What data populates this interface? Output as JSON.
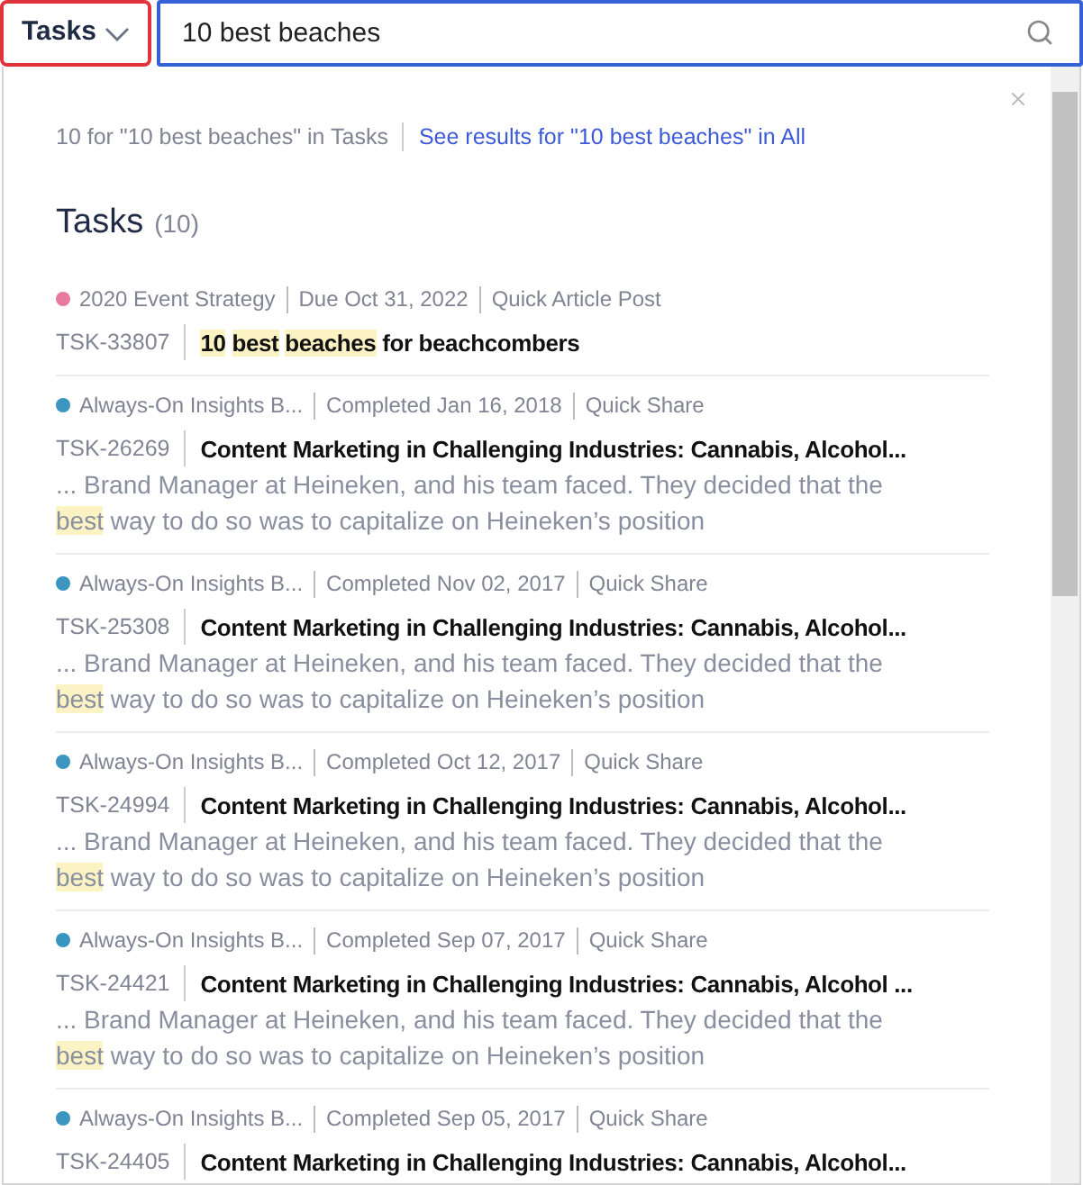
{
  "scope_dropdown": {
    "label": "Tasks"
  },
  "search": {
    "value": "10 best beaches"
  },
  "summary": {
    "count_text": "10 for \"10 best beaches\" in Tasks",
    "link": "See results for \"10 best beaches\" in All"
  },
  "section": {
    "title": "Tasks",
    "count": "(10)"
  },
  "results": [
    {
      "color": "#e8799f",
      "project": "2020 Event Strategy",
      "date": "Due Oct 31, 2022",
      "type": "Quick Article Post",
      "id": "TSK-33807",
      "title": [
        {
          "text": "10",
          "highlight": true
        },
        {
          "text": "best",
          "highlight": true
        },
        {
          "text": "beaches",
          "highlight": true
        },
        {
          "text": "for beachcombers",
          "highlight": false
        }
      ]
    },
    {
      "color": "#3a95c0",
      "project": "Always-On Insights B...",
      "date": "Completed Jan 16, 2018",
      "type": "Quick Share",
      "id": "TSK-26269",
      "title": [
        {
          "text": "Content Marketing in Challenging Industries: Cannabis, Alcohol...",
          "highlight": false
        }
      ],
      "snippet": [
        {
          "text": "... Brand Manager at Heineken, and his team faced. They decided that the",
          "highlight": false
        },
        {
          "text": "best",
          "highlight": true
        },
        {
          "text": "way to do so was to capitalize on Heineken’s position",
          "highlight": false
        }
      ]
    },
    {
      "color": "#3a95c0",
      "project": "Always-On Insights B...",
      "date": "Completed Nov 02, 2017",
      "type": "Quick Share",
      "id": "TSK-25308",
      "title": [
        {
          "text": "Content Marketing in Challenging Industries: Cannabis, Alcohol...",
          "highlight": false
        }
      ],
      "snippet": [
        {
          "text": "... Brand Manager at Heineken, and his team faced. They decided that the",
          "highlight": false
        },
        {
          "text": "best",
          "highlight": true
        },
        {
          "text": "way to do so was to capitalize on Heineken’s position",
          "highlight": false
        }
      ]
    },
    {
      "color": "#3a95c0",
      "project": "Always-On Insights B...",
      "date": "Completed Oct 12, 2017",
      "type": "Quick Share",
      "id": "TSK-24994",
      "title": [
        {
          "text": "Content Marketing in Challenging Industries: Cannabis, Alcohol...",
          "highlight": false
        }
      ],
      "snippet": [
        {
          "text": "... Brand Manager at Heineken, and his team faced. They decided that the",
          "highlight": false
        },
        {
          "text": "best",
          "highlight": true
        },
        {
          "text": "way to do so was to capitalize on Heineken’s position",
          "highlight": false
        }
      ]
    },
    {
      "color": "#3a95c0",
      "project": "Always-On Insights B...",
      "date": "Completed Sep 07, 2017",
      "type": "Quick Share",
      "id": "TSK-24421",
      "title": [
        {
          "text": "Content Marketing in Challenging Industries: Cannabis, Alcohol ...",
          "highlight": false
        }
      ],
      "snippet": [
        {
          "text": "... Brand Manager at Heineken, and his team faced. They decided that the",
          "highlight": false
        },
        {
          "text": "best",
          "highlight": true
        },
        {
          "text": "way to do so was to capitalize on Heineken’s position",
          "highlight": false
        }
      ]
    },
    {
      "color": "#3a95c0",
      "project": "Always-On Insights B...",
      "date": "Completed Sep 05, 2017",
      "type": "Quick Share",
      "id": "TSK-24405",
      "title": [
        {
          "text": "Content Marketing in Challenging Industries: Cannabis, Alcohol...",
          "highlight": false
        }
      ]
    }
  ]
}
